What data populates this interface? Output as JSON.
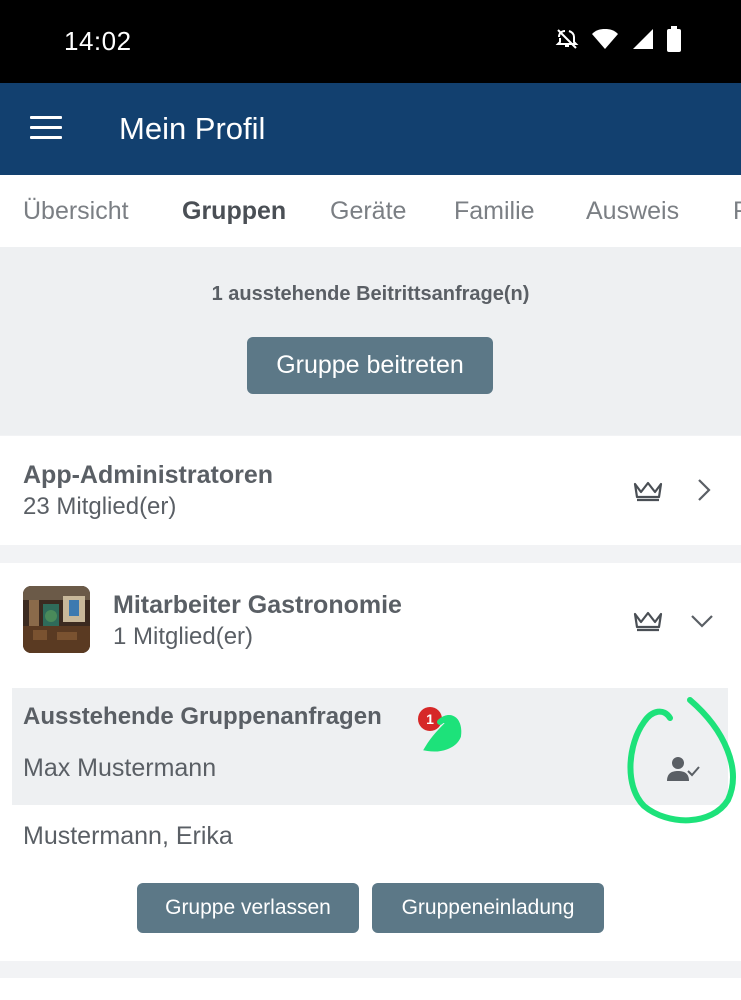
{
  "status_bar": {
    "time": "14:02",
    "icons": [
      "mute-icon",
      "wifi-icon",
      "signal-icon",
      "battery-icon"
    ]
  },
  "app_bar": {
    "title": "Mein Profil",
    "menu_icon": "hamburger-menu-icon"
  },
  "tabs": [
    {
      "label": "Übersicht",
      "active": false
    },
    {
      "label": "Gruppen",
      "active": true
    },
    {
      "label": "Geräte",
      "active": false
    },
    {
      "label": "Familie",
      "active": false
    },
    {
      "label": "Ausweis",
      "active": false
    },
    {
      "label": "F",
      "active": false
    }
  ],
  "pending": {
    "text": "1 ausstehende Beitrittsanfrage(n)",
    "join_button": "Gruppe beitreten"
  },
  "groups": [
    {
      "name": "App-Administratoren",
      "members": "23 Mitglied(er)",
      "icons": [
        "crown-icon",
        "chevron-right-icon"
      ]
    },
    {
      "name": "Mitarbeiter Gastronomie",
      "members": "1 Mitglied(er)",
      "icons": [
        "crown-icon",
        "chevron-down-icon"
      ],
      "requests": {
        "title": "Ausstehende Gruppenanfragen",
        "badge": "1",
        "name": "Max Mustermann",
        "approve_icon": "person-check-icon"
      },
      "member_list": [
        "Mustermann, Erika"
      ],
      "buttons": {
        "leave": "Gruppe verlassen",
        "invite": "Gruppeneinladung"
      }
    }
  ],
  "colors": {
    "app_bar": "#12406f",
    "button": "#5c7887",
    "badge": "#d62828",
    "highlight": "#1de27a"
  }
}
